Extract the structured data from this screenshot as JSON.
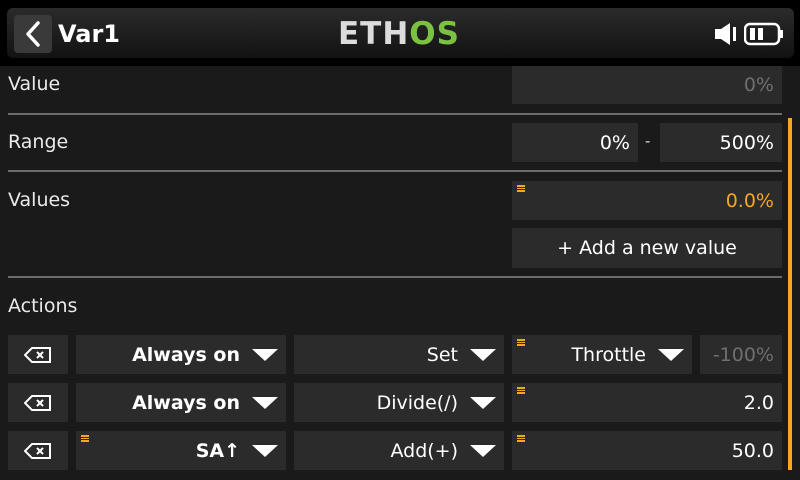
{
  "header": {
    "title": "Var1",
    "logo_main": "ETH",
    "logo_accent": "OS"
  },
  "value_row": {
    "label": "Value",
    "value": "0%"
  },
  "range_row": {
    "label": "Range",
    "min": "0%",
    "separator": "-",
    "max": "500%"
  },
  "values_row": {
    "label": "Values",
    "value": "0.0%",
    "add_button": "+ Add a new value"
  },
  "actions": {
    "label": "Actions",
    "rows": [
      {
        "condition": "Always on",
        "operation": "Set",
        "source": "Throttle",
        "value": "-100%"
      },
      {
        "condition": "Always on",
        "operation": "Divide(/)",
        "value": "2.0"
      },
      {
        "condition": "SA↑",
        "operation": "Add(+)",
        "value": "50.0"
      }
    ]
  },
  "colors": {
    "accent": "#f5a623",
    "logo_green": "#7cc242"
  }
}
